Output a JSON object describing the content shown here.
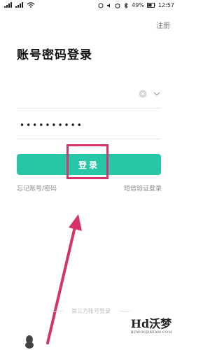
{
  "status_bar": {
    "battery_percent": "49%",
    "time": "12:57"
  },
  "header": {
    "register_label": "注册",
    "title": "账号密码登录"
  },
  "form": {
    "account_value": "",
    "password_masked": "••••••••••"
  },
  "actions": {
    "login_label": "登录",
    "forgot_label": "忘记账号/密码",
    "sms_login_label": "短信验证登录"
  },
  "footer": {
    "third_party_label": "第三方账号登录"
  },
  "watermark": {
    "main": "Hd沃梦",
    "sub": "HDWOODREAM.COM"
  },
  "colors": {
    "accent": "#26c6a7",
    "annotation": "#d6336c"
  }
}
